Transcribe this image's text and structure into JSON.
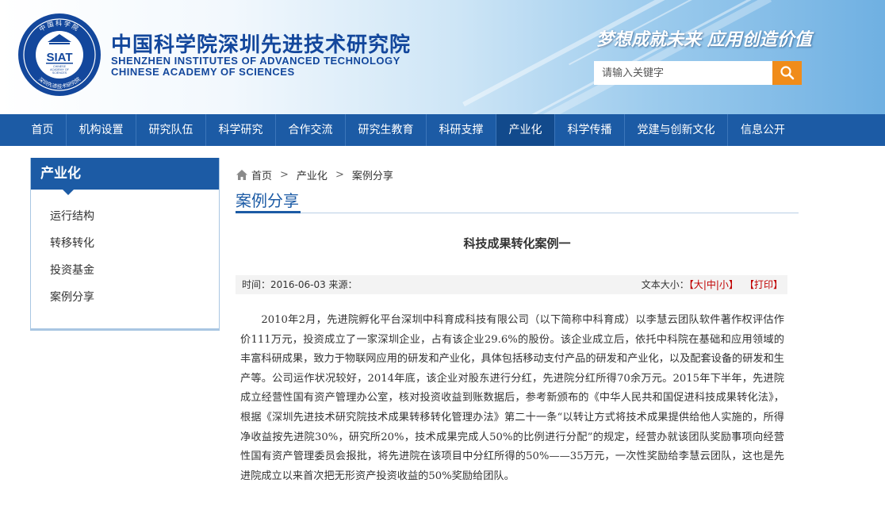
{
  "header": {
    "logo_text": "SIAT",
    "logo_ring_top": "中国科学院",
    "logo_ring_bottom": "深圳先进技术研究院",
    "logo_small_lines": [
      "CHINESE",
      "ACADEMY OF",
      "SCIENCES"
    ],
    "cn_name": "中国科学院深圳先进技术研究院",
    "en_name_line1": "SHENZHEN INSTITUTES OF ADVANCED TECHNOLOGY",
    "en_name_line2": "CHINESE ACADEMY OF SCIENCES",
    "slogan": "梦想成就未来 应用创造价值",
    "search_placeholder": "请输入关键字",
    "search_icon": "search-icon"
  },
  "nav": {
    "items": [
      "首页",
      "机构设置",
      "研究队伍",
      "科学研究",
      "合作交流",
      "研究生教育",
      "科研支撑",
      "产业化",
      "科学传播",
      "党建与创新文化",
      "信息公开"
    ]
  },
  "sidebar": {
    "title": "产业化",
    "items": [
      "运行结构",
      "转移转化",
      "投资基金",
      "案例分享"
    ]
  },
  "breadcrumb": {
    "home_icon": "home-icon",
    "items": [
      "首页",
      "产业化",
      "案例分享"
    ],
    "separator": ">"
  },
  "page_title": "案例分享",
  "article": {
    "title": "科技成果转化案例一",
    "meta_time": "时间：2016-06-03 来源：",
    "font_size_label": "文本大小：",
    "font_size_options": [
      "大",
      "中",
      "小"
    ],
    "print_label": "打印",
    "body": "2010年2月，先进院孵化平台深圳中科育成科技有限公司（以下简称中科育成）以李慧云团队软件著作权评估作价111万元，投资成立了一家深圳企业，占有该企业29.6%的股份。该企业成立后，依托中科院在基础和应用领域的丰富科研成果，致力于物联网应用的研发和产业化，具体包括移动支付产品的研发和产业化，以及配套设备的研发和生产等。公司运作状况较好，2014年底，该企业对股东进行分红，先进院分红所得70余万元。2015年下半年，先进院成立经营性国有资产管理办公室，核对投资收益到账数据后，参考新颁布的《中华人民共和国促进科技成果转化法》，根据《深圳先进技术研究院技术成果转移转化管理办法》第二十一条“以转让方式将技术成果提供给他人实施的，所得净收益按先进院30%，研究所20%，技术成果完成人50%的比例进行分配”的规定，经营办就该团队奖励事项向经营性国有资产管理委员会报批，将先进院在该项目中分红所得的50%——35万元，一次性奖励给李慧云团队，这也是先进院成立以来首次把无形资产投资收益的50%奖励给团队。"
  },
  "colors": {
    "nav_blue": "#1c5ba5",
    "brand_text": "#13479c",
    "search_orange": "#f08c1a",
    "accent_red": "#c00000"
  }
}
